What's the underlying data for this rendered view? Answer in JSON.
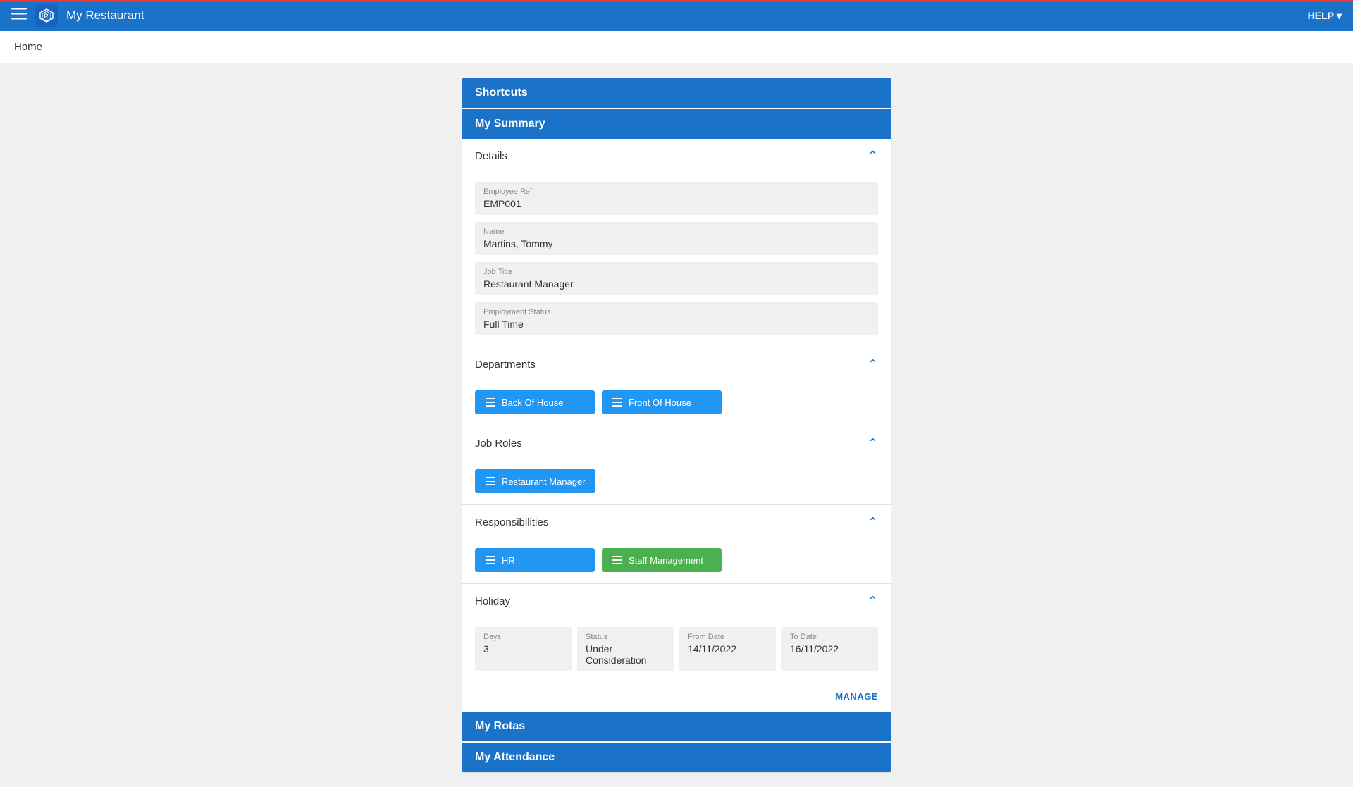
{
  "app": {
    "title": "My Restaurant",
    "help_label": "HELP",
    "breadcrumb": "Home"
  },
  "shortcuts": {
    "label": "Shortcuts"
  },
  "my_summary": {
    "label": "My Summary"
  },
  "details": {
    "section_label": "Details",
    "employee_ref_label": "Employee Ref",
    "employee_ref_value": "EMP001",
    "name_label": "Name",
    "name_value": "Martins, Tommy",
    "job_title_label": "Job Title",
    "job_title_value": "Restaurant Manager",
    "employment_status_label": "Employment Status",
    "employment_status_value": "Full Time"
  },
  "departments": {
    "section_label": "Departments",
    "items": [
      {
        "label": "Back Of House"
      },
      {
        "label": "Front Of House"
      }
    ]
  },
  "job_roles": {
    "section_label": "Job Roles",
    "items": [
      {
        "label": "Restaurant Manager"
      }
    ]
  },
  "responsibilities": {
    "section_label": "Responsibilities",
    "items": [
      {
        "label": "HR",
        "color": "blue"
      },
      {
        "label": "Staff Management",
        "color": "green"
      }
    ]
  },
  "holiday": {
    "section_label": "Holiday",
    "days_label": "Days",
    "days_value": "3",
    "status_label": "Status",
    "status_value": "Under Consideration",
    "from_date_label": "From Date",
    "from_date_value": "14/11/2022",
    "to_date_label": "To Date",
    "to_date_value": "16/11/2022",
    "manage_label": "MANAGE"
  },
  "my_rotas": {
    "label": "My Rotas"
  },
  "my_attendance": {
    "label": "My Attendance"
  },
  "icons": {
    "hamburger": "☰",
    "chevron_up": "▲",
    "chevron_down": "▼",
    "list": "≡"
  }
}
